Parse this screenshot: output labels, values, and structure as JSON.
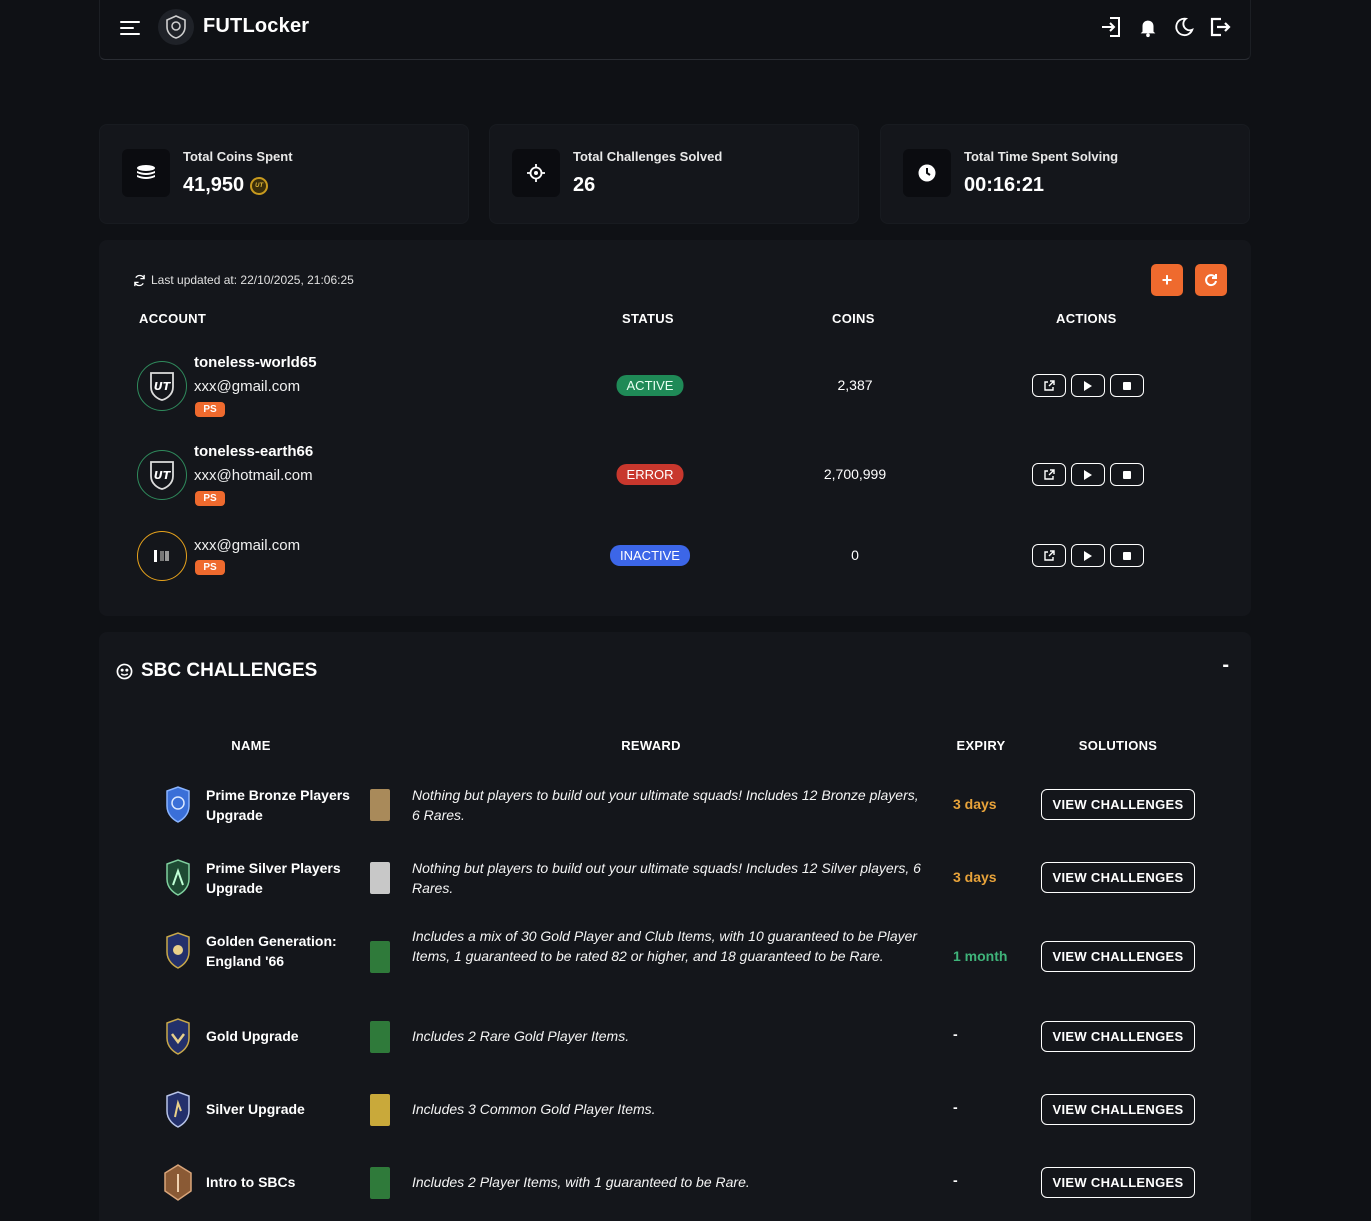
{
  "header": {
    "title": "FUTLocker",
    "icons": [
      "menu-icon",
      "logo-icon",
      "login-icon",
      "bell-icon",
      "moon-icon",
      "logout-icon"
    ]
  },
  "stats": [
    {
      "label": "Total Coins Spent",
      "value": "41,950",
      "icon": "coins-icon",
      "suffix": "UT"
    },
    {
      "label": "Total Challenges Solved",
      "value": "26",
      "icon": "crosshair-icon"
    },
    {
      "label": "Total Time Spent Solving",
      "value": "00:16:21",
      "icon": "clock-icon"
    }
  ],
  "accounts": {
    "last_updated": "Last updated at: 22/10/2025, 21:06:25",
    "add_label": "+",
    "columns": {
      "account": "ACCOUNT",
      "status": "STATUS",
      "coins": "COINS",
      "actions": "ACTIONS"
    },
    "rows": [
      {
        "name": "toneless-world65",
        "email": "xxx@gmail.com",
        "platform": "PS",
        "status": "ACTIVE",
        "coins": "2,387"
      },
      {
        "name": "toneless-earth66",
        "email": "xxx@hotmail.com",
        "platform": "PS",
        "status": "ERROR",
        "coins": "2,700,999"
      },
      {
        "name": "",
        "email": "xxx@gmail.com",
        "platform": "PS",
        "status": "INACTIVE",
        "coins": "0"
      }
    ]
  },
  "sbc": {
    "title": "SBC CHALLENGES",
    "collapse_label": "-",
    "columns": {
      "name": "NAME",
      "reward": "REWARD",
      "expiry": "EXPIRY",
      "solutions": "SOLUTIONS"
    },
    "view_label": "VIEW CHALLENGES",
    "rows": [
      {
        "name": "Prime Bronze Players Upgrade",
        "reward": "Nothing but players to build out your ultimate squads! Includes 12 Bronze players, 6 Rares.",
        "expiry": "3 days",
        "expiry_color": "#e8a33a",
        "pack_color": "#a98a5a"
      },
      {
        "name": "Prime Silver Players Upgrade",
        "reward": "Nothing but players to build out your ultimate squads! Includes 12 Silver players, 6 Rares.",
        "expiry": "3 days",
        "expiry_color": "#e8a33a",
        "pack_color": "#c8c8c8"
      },
      {
        "name": "Golden Generation: England '66",
        "reward": "Includes a mix of 30 Gold Player and Club Items, with 10 guaranteed to be Player Items, 1 guaranteed to be rated 82 or higher, and 18 guaranteed to be Rare.",
        "expiry": "1 month",
        "expiry_color": "#3fb47a",
        "pack_color": "#2f7a3a"
      },
      {
        "name": "Gold Upgrade",
        "reward": "Includes 2 Rare Gold Player Items.",
        "expiry": "-",
        "expiry_color": "#ffffff",
        "pack_color": "#2f7a3a"
      },
      {
        "name": "Silver Upgrade",
        "reward": "Includes 3 Common Gold Player Items.",
        "expiry": "-",
        "expiry_color": "#ffffff",
        "pack_color": "#c9a93a"
      },
      {
        "name": "Intro to SBCs",
        "reward": "Includes 2 Player Items, with 1 guaranteed to be Rare.",
        "expiry": "-",
        "expiry_color": "#ffffff",
        "pack_color": "#2f7a3a"
      }
    ]
  }
}
